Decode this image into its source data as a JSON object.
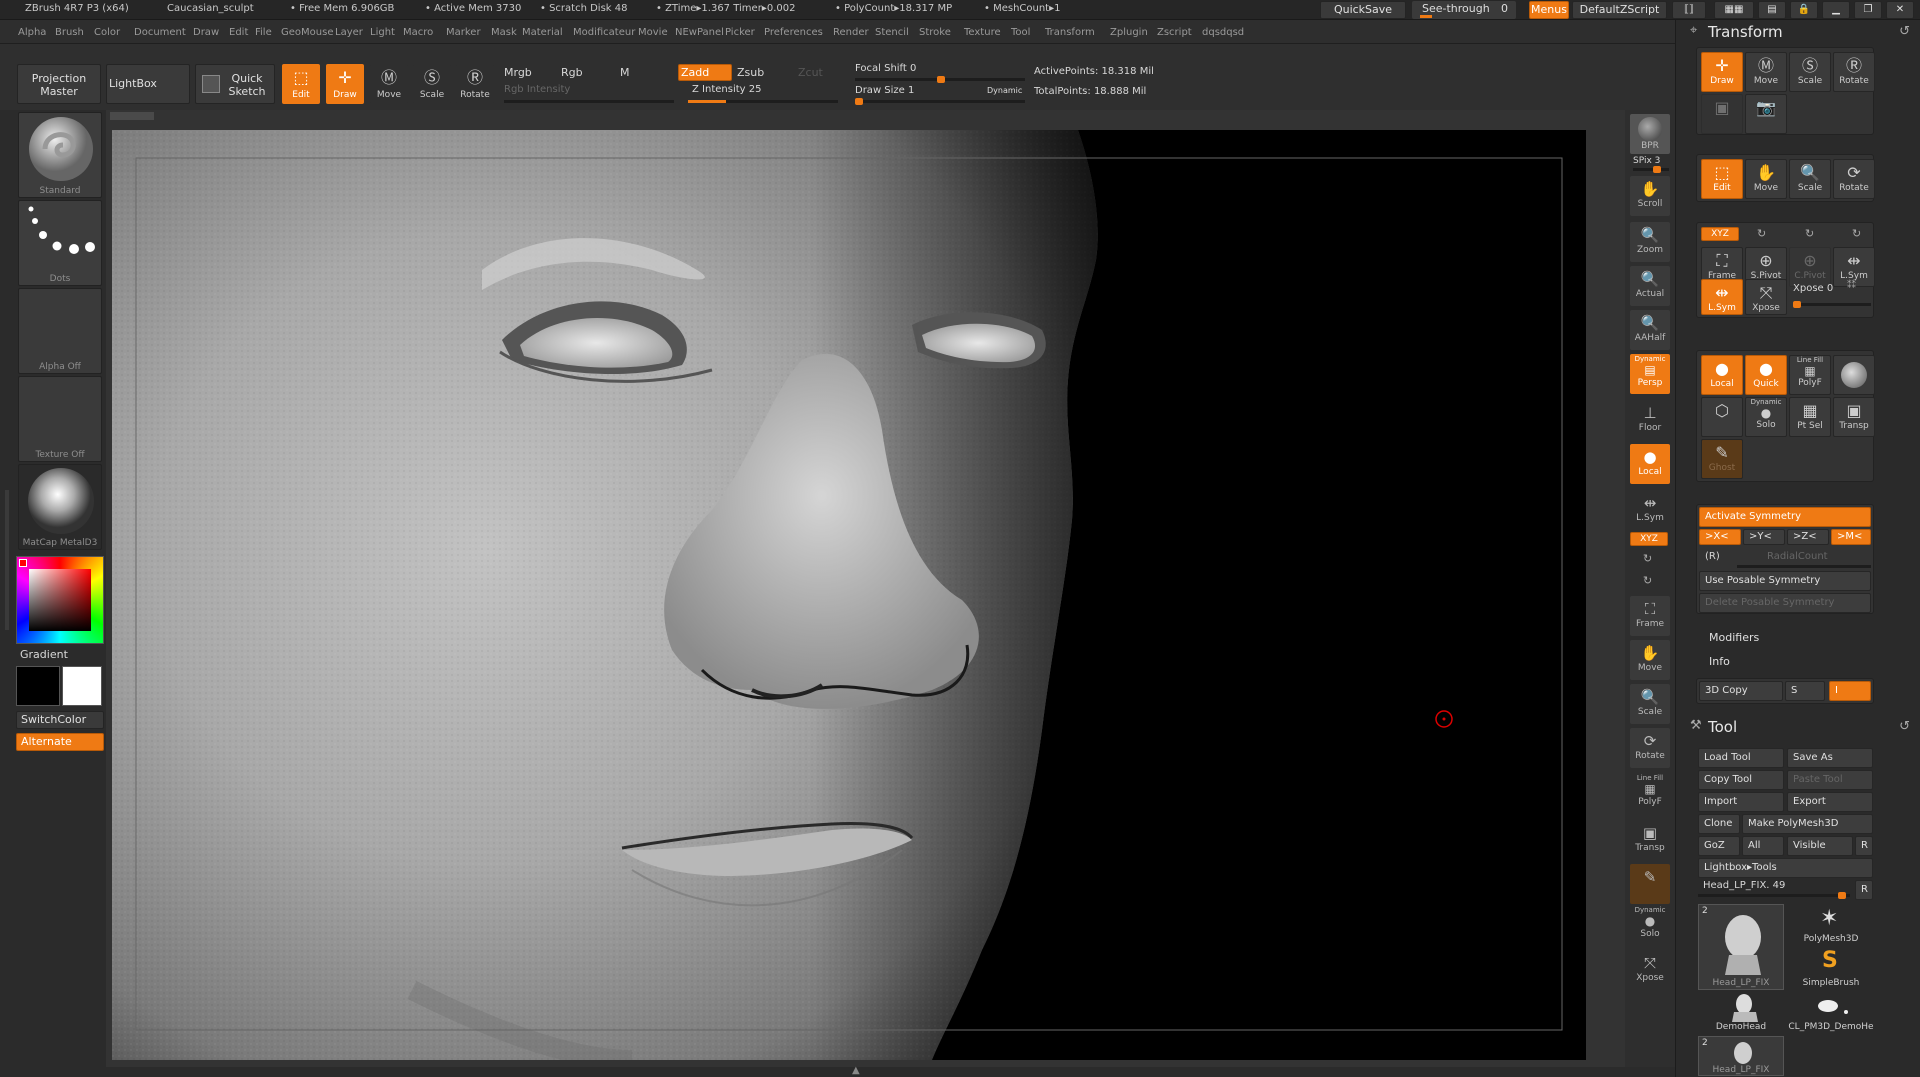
{
  "titlebar": {
    "app": "ZBrush 4R7 P3 (x64)",
    "doc": "Caucasian_sculpt",
    "free_mem": "• Free Mem 6.906GB",
    "active_mem": "• Active Mem 3730",
    "scratch": "• Scratch Disk 48",
    "ztime": "• ZTime▸1.367 Timer▸0.002",
    "polycount": "• PolyCount▸18.317 MP",
    "meshcount": "• MeshCount▸1",
    "quicksave": "QuickSave",
    "seethrough": "See-through",
    "seethrough_val": "0",
    "menus": "Menus",
    "zscript": "DefaultZScript"
  },
  "menu": [
    "Alpha",
    "Brush",
    "Color",
    "Document",
    "Draw",
    "Edit",
    "File",
    "GeoMouse",
    "Layer",
    "Light",
    "Macro",
    "Marker",
    "Mask",
    "Material",
    "Modificateur",
    "Movie",
    "NEwPanel",
    "Picker",
    "Preferences",
    "Render",
    "Stencil",
    "Stroke",
    "Texture",
    "Tool",
    "Transform",
    "Zplugin",
    "Zscript",
    "dqsdqsd"
  ],
  "shelf": {
    "projection_master": "Projection Master",
    "lightbox": "LightBox",
    "quick_sketch": "Quick Sketch",
    "edit": "Edit",
    "draw": "Draw",
    "move": "Move",
    "scale": "Scale",
    "rotate": "Rotate",
    "mrgb": "Mrgb",
    "rgb": "Rgb",
    "m": "M",
    "rgb_intensity": "Rgb Intensity",
    "zadd": "Zadd",
    "zsub": "Zsub",
    "zcut": "Zcut",
    "z_intensity": "Z Intensity 25",
    "focal_shift": "Focal Shift 0",
    "draw_size": "Draw Size 1",
    "dynamic": "Dynamic",
    "active_points": "ActivePoints: 18.318 Mil",
    "total_points": "TotalPoints: 18.888 Mil",
    "z_intensity_level": 0.25
  },
  "left_tray": {
    "standard": "Standard",
    "dots": "Dots",
    "alpha_off": "Alpha Off",
    "texture_off": "Texture Off",
    "matcap": "MatCap MetalD3",
    "gradient": "Gradient",
    "switchcolor": "SwitchColor",
    "alternate": "Alternate"
  },
  "right_shelf": {
    "bpr": "BPR",
    "spix": "SPix 3",
    "scroll": "Scroll",
    "zoom": "Zoom",
    "actual": "Actual",
    "aahalf": "AAHalf",
    "dynamic": "Dynamic",
    "persp": "Persp",
    "floor": "Floor",
    "local": "Local",
    "lsym": "L.Sym",
    "xyz": "XYZ",
    "frame": "Frame",
    "move": "Move",
    "scale": "Scale",
    "rotate": "Rotate",
    "line_fill": "Line Fill",
    "polyf": "PolyF",
    "transp": "Transp",
    "dynamic2": "Dynamic",
    "solo": "Solo",
    "xpose": "Xpose"
  },
  "transform": {
    "title": "Transform",
    "draw": "Draw",
    "move": "Move",
    "scale": "Scale",
    "rotate": "Rotate",
    "edit": "Edit",
    "move2": "Move",
    "scale2": "Scale",
    "rotate2": "Rotate",
    "xyz": "XYZ",
    "frame": "Frame",
    "spivot": "S.Pivot",
    "cpivot": "C.Pivot",
    "lsym": "L.Sym",
    "lsym2": "L.Sym",
    "xpose": "Xpose",
    "xpose_val": "Xpose 0",
    "local": "Local",
    "quick": "Quick",
    "line_fill": "Line Fill",
    "polyf": "PolyF",
    "dynamic": "Dynamic",
    "solo": "Solo",
    "ptsel": "Pt Sel",
    "transp": "Transp",
    "ghost": "Ghost",
    "activate_symmetry": "Activate Symmetry",
    "sym_x": ">X<",
    "sym_y": ">Y<",
    "sym_z": ">Z<",
    "sym_m": ">M<",
    "sym_r": "(R)",
    "radialcount": "RadialCount",
    "use_posable": "Use Posable Symmetry",
    "delete_posable": "Delete Posable Symmetry",
    "modifiers": "Modifiers",
    "info": "Info",
    "copy3d": "3D Copy",
    "copy3d_s": "S",
    "copy3d_i": "I"
  },
  "tool": {
    "title": "Tool",
    "load_tool": "Load Tool",
    "save_as": "Save As",
    "copy_tool": "Copy Tool",
    "paste_tool": "Paste Tool",
    "import": "Import",
    "export": "Export",
    "clone": "Clone",
    "make_polymesh": "Make PolyMesh3D",
    "goz": "GoZ",
    "all": "All",
    "visible": "Visible",
    "r": "R",
    "lightbox_tools": "Lightbox▸Tools",
    "current_tool": "Head_LP_FIX. 49",
    "r2": "R",
    "thumbs": [
      {
        "name": "Head_LP_FIX",
        "badge": "2"
      },
      {
        "name": "PolyMesh3D",
        "badge": ""
      },
      {
        "name": "SimpleBrush",
        "badge": ""
      },
      {
        "name": "DemoHead",
        "badge": ""
      },
      {
        "name": "CL_PM3D_DemoHe",
        "badge": ""
      },
      {
        "name": "Head_LP_FIX",
        "badge": "2"
      }
    ]
  }
}
